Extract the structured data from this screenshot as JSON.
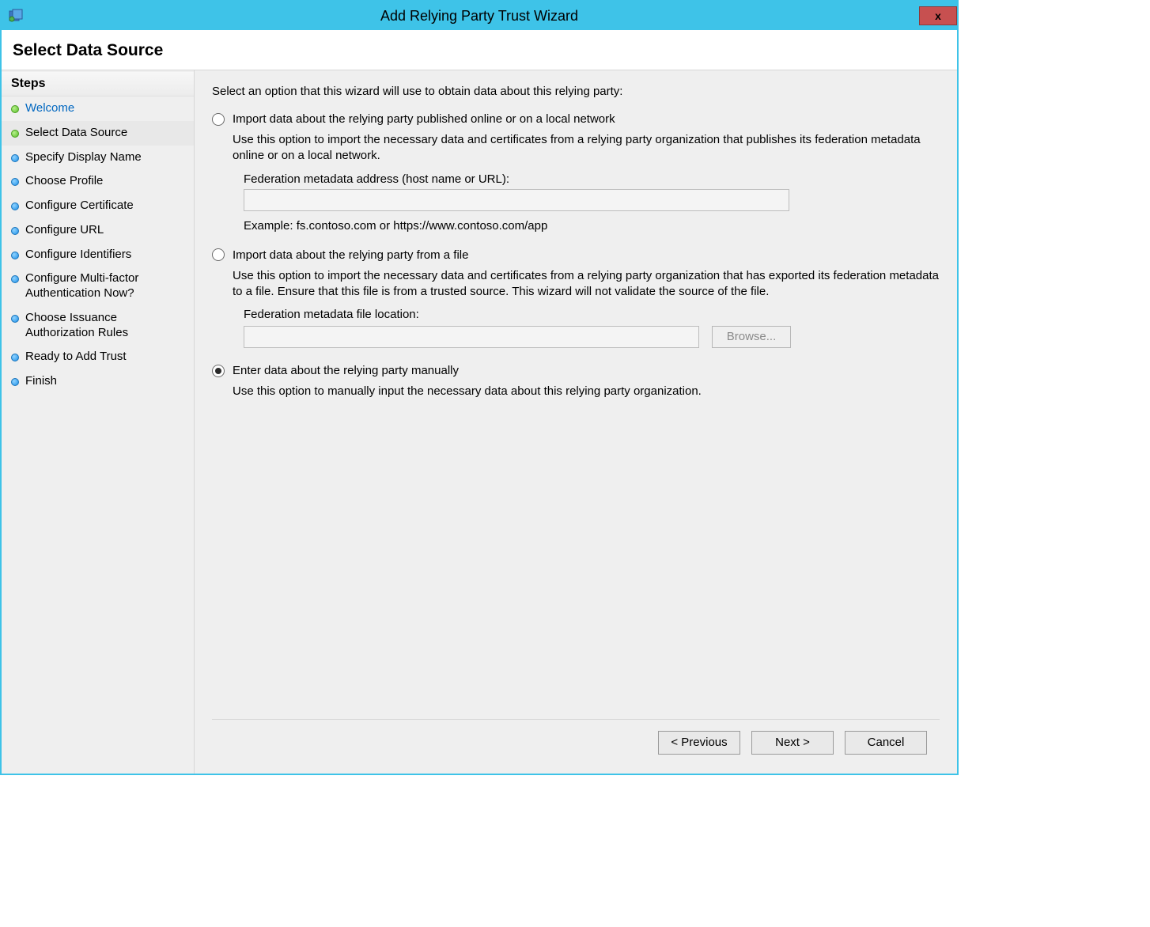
{
  "window": {
    "title": "Add Relying Party Trust Wizard",
    "close_label": "x"
  },
  "header": {
    "title": "Select Data Source"
  },
  "sidebar": {
    "heading": "Steps",
    "items": [
      {
        "label": "Welcome",
        "bullet": "green",
        "link": true,
        "current": false
      },
      {
        "label": "Select Data Source",
        "bullet": "green",
        "link": false,
        "current": true
      },
      {
        "label": "Specify Display Name",
        "bullet": "blue",
        "link": false,
        "current": false
      },
      {
        "label": "Choose Profile",
        "bullet": "blue",
        "link": false,
        "current": false
      },
      {
        "label": "Configure Certificate",
        "bullet": "blue",
        "link": false,
        "current": false
      },
      {
        "label": "Configure URL",
        "bullet": "blue",
        "link": false,
        "current": false
      },
      {
        "label": "Configure Identifiers",
        "bullet": "blue",
        "link": false,
        "current": false
      },
      {
        "label": "Configure Multi-factor Authentication Now?",
        "bullet": "blue",
        "link": false,
        "current": false
      },
      {
        "label": "Choose Issuance Authorization Rules",
        "bullet": "blue",
        "link": false,
        "current": false
      },
      {
        "label": "Ready to Add Trust",
        "bullet": "blue",
        "link": false,
        "current": false
      },
      {
        "label": "Finish",
        "bullet": "blue",
        "link": false,
        "current": false
      }
    ]
  },
  "main": {
    "intro": "Select an option that this wizard will use to obtain data about this relying party:",
    "options": [
      {
        "title": "Import data about the relying party published online or on a local network",
        "desc": "Use this option to import the necessary data and certificates from a relying party organization that publishes its federation metadata online or on a local network.",
        "field_label": "Federation metadata address (host name or URL):",
        "field_value": "",
        "example": "Example: fs.contoso.com or https://www.contoso.com/app",
        "selected": false
      },
      {
        "title": "Import data about the relying party from a file",
        "desc": "Use this option to import the necessary data and certificates from a relying party organization that has exported its federation metadata to a file. Ensure that this file is from a trusted source.  This wizard will not validate the source of the file.",
        "field_label": "Federation metadata file location:",
        "field_value": "",
        "browse_label": "Browse...",
        "selected": false
      },
      {
        "title": "Enter data about the relying party manually",
        "desc": "Use this option to manually input the necessary data about this relying party organization.",
        "selected": true
      }
    ]
  },
  "footer": {
    "previous": "< Previous",
    "next": "Next >",
    "cancel": "Cancel"
  }
}
